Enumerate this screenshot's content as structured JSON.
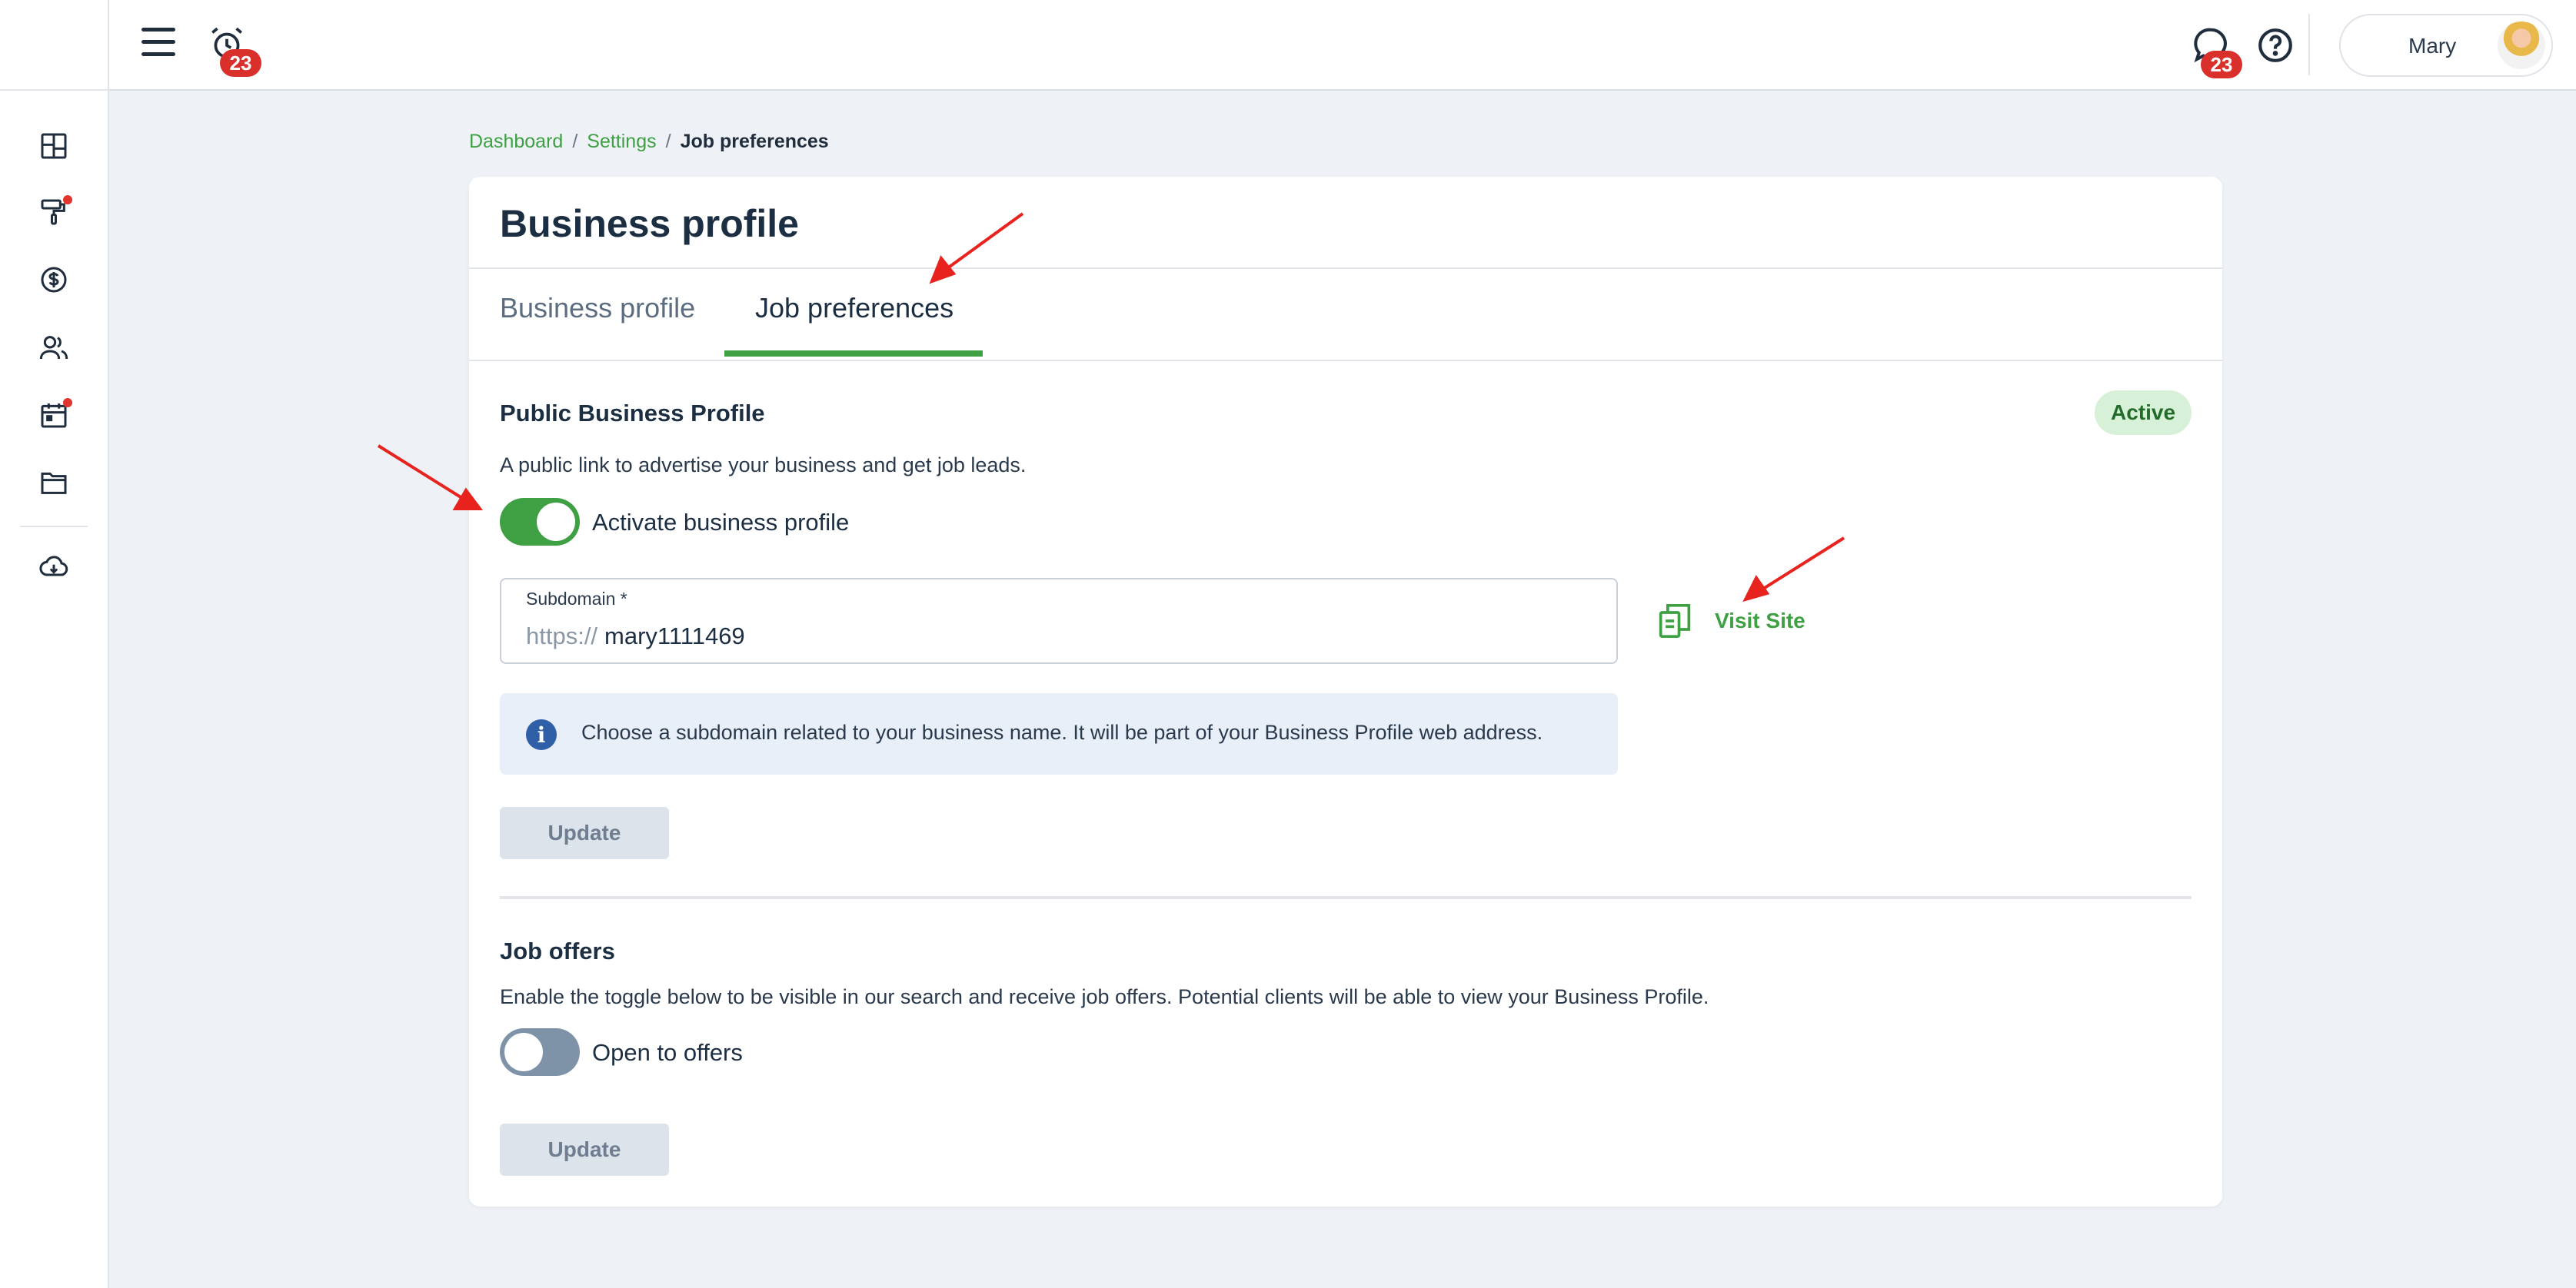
{
  "topbar": {
    "alarm_badge": "23",
    "chat_badge": "23",
    "user_name": "Mary"
  },
  "sidebar": {
    "items": [
      {
        "icon": "dashboard-icon"
      },
      {
        "icon": "paint-roller-icon",
        "dot": true
      },
      {
        "icon": "dollar-icon"
      },
      {
        "icon": "users-icon"
      },
      {
        "icon": "calendar-icon",
        "dot": true
      },
      {
        "icon": "folder-icon"
      },
      {
        "icon": "cloud-download-icon"
      }
    ]
  },
  "breadcrumb": {
    "home": "Dashboard",
    "settings": "Settings",
    "current": "Job preferences",
    "separator": "/"
  },
  "card": {
    "title": "Business profile",
    "tabs": [
      {
        "label": "Business profile",
        "active": false
      },
      {
        "label": "Job preferences",
        "active": true
      }
    ]
  },
  "public_profile": {
    "title": "Public Business Profile",
    "status": "Active",
    "description": "A public link to advertise your business and get job leads.",
    "toggle_label": "Activate business profile",
    "toggle_on": true,
    "subdomain_label": "Subdomain *",
    "subdomain_prefix": "https://",
    "subdomain_value": "mary1111469",
    "visit_label": "Visit Site",
    "info_text": "Choose a subdomain related to your business name. It will be part of your Business Profile web address.",
    "update_label": "Update"
  },
  "job_offers": {
    "title": "Job offers",
    "description": "Enable the toggle below to be visible in our search and receive job offers. Potential clients will be able to view your Business Profile.",
    "toggle_label": "Open to offers",
    "toggle_on": false,
    "update_label": "Update"
  },
  "colors": {
    "accent": "#3ea043",
    "badge": "#d9302c",
    "annotation": "#e8231e"
  }
}
